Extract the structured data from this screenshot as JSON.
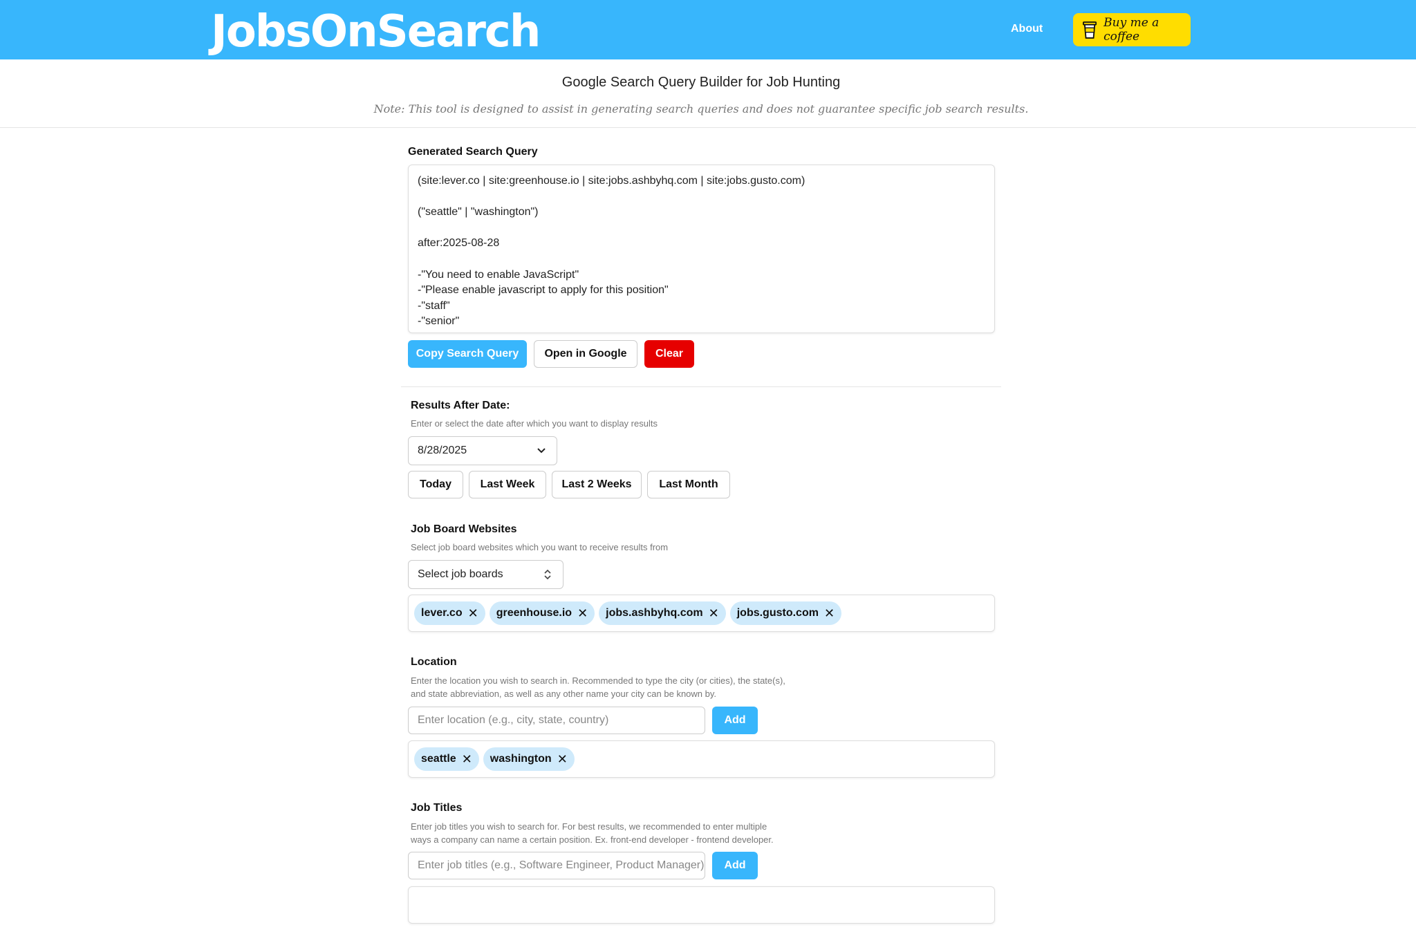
{
  "header": {
    "logo": "JobsOnSearch",
    "about_label": "About",
    "coffee_label": "Buy me a coffee",
    "bg_color": "#38b6fc"
  },
  "intro": {
    "title": "Google Search Query Builder for Job Hunting",
    "note": "Note: This tool is designed to assist in generating search queries and does not guarantee specific job search results."
  },
  "query": {
    "label": "Generated Search Query",
    "text": "(site:lever.co | site:greenhouse.io | site:jobs.ashbyhq.com | site:jobs.gusto.com)\n\n(\"seattle\" | \"washington\")\n\nafter:2025-08-28\n\n-\"You need to enable JavaScript\"\n-\"Please enable javascript to apply for this position\"\n-\"staff\"\n-\"senior\"",
    "copy_label": "Copy Search Query",
    "open_label": "Open in Google",
    "clear_label": "Clear"
  },
  "date": {
    "label": "Results After Date:",
    "help": "Enter or select the date after which you want to display results",
    "value": "8/28/2025",
    "quick": [
      "Today",
      "Last Week",
      "Last 2 Weeks",
      "Last Month"
    ]
  },
  "boards": {
    "label": "Job Board Websites",
    "help": "Select job board websites which you want to receive results from",
    "select_label": "Select job boards",
    "chips": [
      "lever.co",
      "greenhouse.io",
      "jobs.ashbyhq.com",
      "jobs.gusto.com"
    ]
  },
  "location": {
    "label": "Location",
    "help_line1": "Enter the location you wish to search in. Recommended to type the city (or cities), the state(s),",
    "help_line2": "and state abbreviation, as well as any other name your city can be known by.",
    "placeholder": "Enter location (e.g., city, state, country)",
    "add_label": "Add",
    "chips": [
      "seattle",
      "washington"
    ]
  },
  "titles": {
    "label": "Job Titles",
    "help_line1": "Enter job titles you wish to search for. For best results, we recommended to enter multiple",
    "help_line2": "ways a company can name a certain position. Ex. front-end developer - frontend developer.",
    "placeholder": "Enter job titles (e.g., Software Engineer, Product Manager)",
    "add_label": "Add"
  }
}
